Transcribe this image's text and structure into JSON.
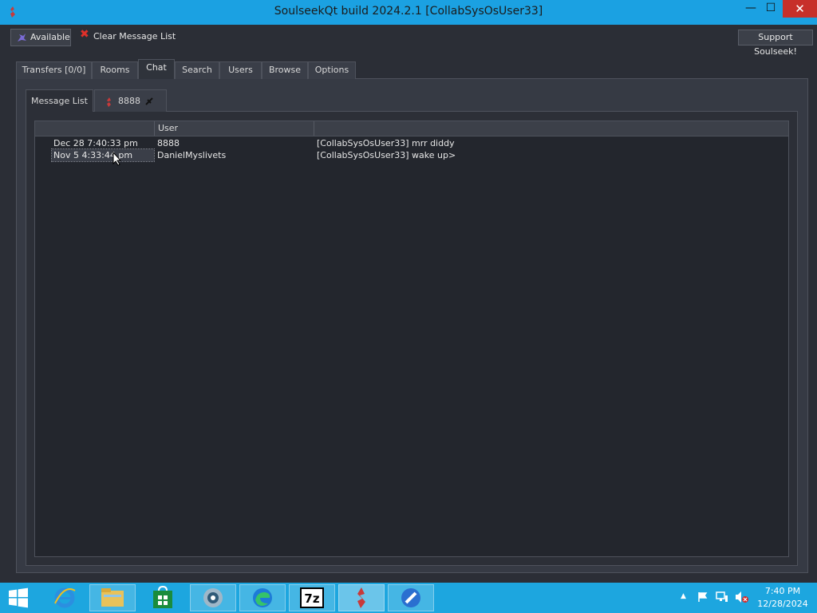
{
  "window": {
    "title": "SoulseekQt build 2024.2.1 [CollabSysOsUser33]",
    "minimize_label": "—",
    "maximize_label": "☐",
    "close_label": "✕"
  },
  "toolbar": {
    "status_label": "Available",
    "clear_label": "Clear Message List",
    "support_label": "Support Soulseek!"
  },
  "tabs": [
    {
      "label": "Transfers [0/0]"
    },
    {
      "label": "Rooms"
    },
    {
      "label": "Chat",
      "active": true
    },
    {
      "label": "Search"
    },
    {
      "label": "Users"
    },
    {
      "label": "Browse"
    },
    {
      "label": "Options"
    }
  ],
  "subtabs": [
    {
      "label": "Message List",
      "active": true
    },
    {
      "label": "8888"
    }
  ],
  "table": {
    "headers": [
      "",
      "User",
      ""
    ],
    "rows": [
      {
        "time": "Dec 28 7:40:33 pm",
        "user": "8888",
        "message": "[CollabSysOsUser33] mrr diddy"
      },
      {
        "time": "Nov 5 4:33:44 pm",
        "user": "DanielMyslivets",
        "message": "[CollabSysOsUser33] wake up>",
        "selected": true
      }
    ]
  },
  "taskbar": {
    "items": [
      "internet-explorer-icon",
      "file-explorer-icon",
      "store-icon",
      "app-icon",
      "edge-icon",
      "7zip-icon",
      "soulseek-icon",
      "app-icon"
    ],
    "clock_time": "7:40 PM",
    "clock_date": "12/28/2024"
  },
  "colors": {
    "titlebar": "#1ba1e2",
    "close": "#c7302a",
    "background": "#2b2e36",
    "taskbar": "#1da6df"
  }
}
